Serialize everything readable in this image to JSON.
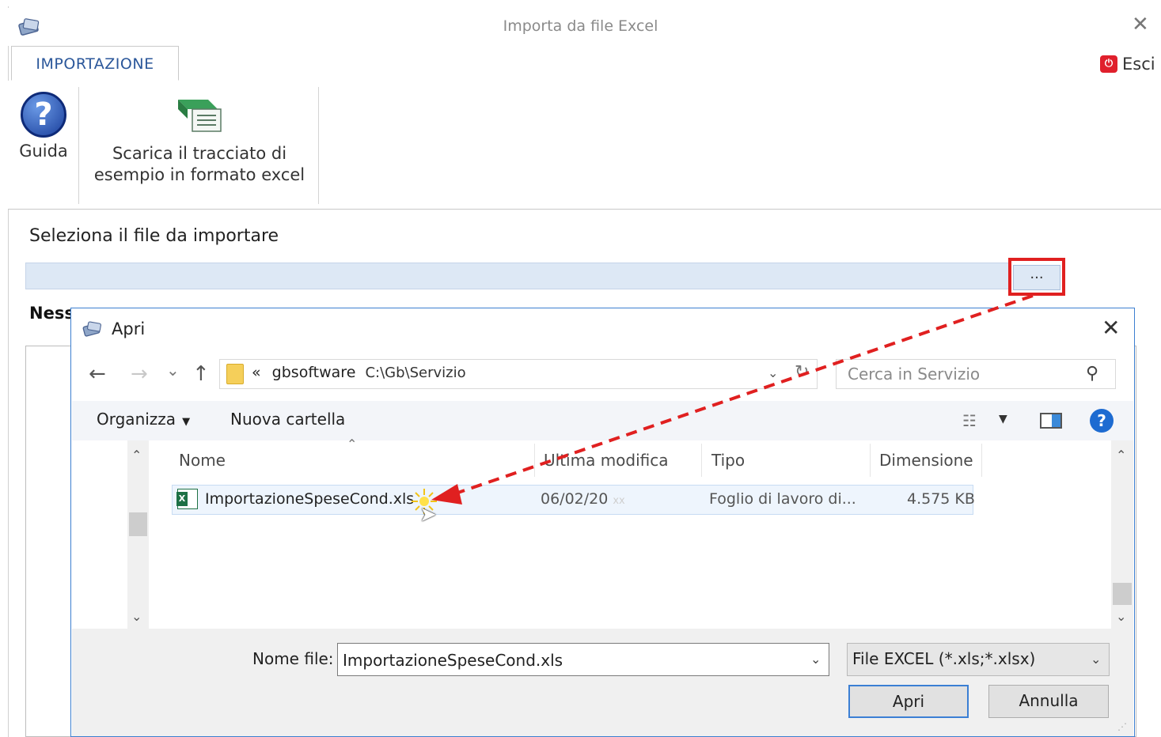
{
  "window": {
    "title": "Importa da file Excel",
    "close_glyph": "✕",
    "tab_label": "IMPORTAZIONE",
    "exit_label": "Esci",
    "exit_icon": "power-icon"
  },
  "ribbon": {
    "help_label": "Guida",
    "help_glyph": "?",
    "download_line1": "Scarica il tracciato di",
    "download_line2": "esempio in formato excel"
  },
  "import": {
    "section_label": "Seleziona il file da importare",
    "path_value": "",
    "browse_label": "...",
    "no_file_text": "Ness"
  },
  "dialog": {
    "title": "Apri",
    "close_glyph": "✕",
    "nav": {
      "back": "←",
      "forward": "→",
      "recent": "⌄",
      "up": "↑"
    },
    "address": {
      "chevron": "«",
      "folder": "gbsoftware",
      "path": "C:\\Gb\\Servizio"
    },
    "search_placeholder": "Cerca in Servizio",
    "toolbar": {
      "organize": "Organizza",
      "new_folder": "Nuova cartella",
      "help_glyph": "?"
    },
    "columns": {
      "name": "Nome",
      "modified": "Ultima modifica",
      "type": "Tipo",
      "size": "Dimensione"
    },
    "files": [
      {
        "name": "ImportazioneSpeseCond.xls",
        "modified": "06/02/20",
        "modified_extra": "xx",
        "type": "Foglio di lavoro di...",
        "size": "4.575 KB"
      }
    ],
    "filename_label": "Nome file:",
    "filename_value": "ImportazioneSpeseCond.xls",
    "filetype_value": "File EXCEL (*.xls;*.xlsx)",
    "open_button": "Apri",
    "cancel_button": "Annulla"
  },
  "colors": {
    "accent": "#2b579a",
    "dialog_border": "#3c7fd0",
    "annotation_red": "#e02020",
    "selection_bg": "#eef5fd",
    "path_field_bg": "#dde8f5"
  }
}
